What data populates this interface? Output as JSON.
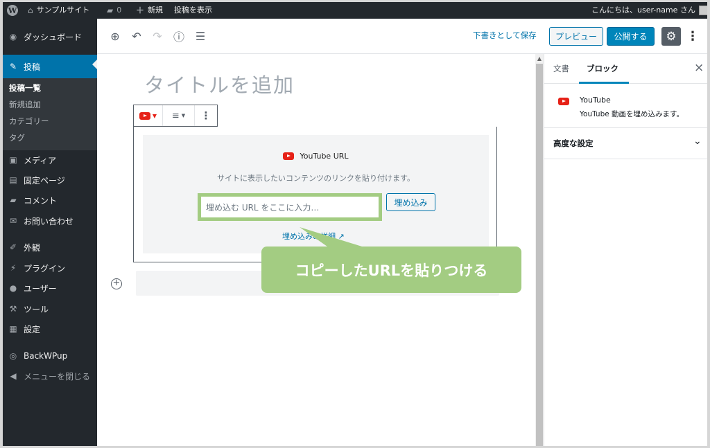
{
  "adminbar": {
    "site_name": "サンプルサイト",
    "comments_count": "0",
    "new_label": "新規",
    "view_post_label": "投稿を表示",
    "greeting": "こんにちは、user-name さん"
  },
  "sidebar": {
    "dashboard": "ダッシュボード",
    "posts": "投稿",
    "submenu": [
      "投稿一覧",
      "新規追加",
      "カテゴリー",
      "タグ"
    ],
    "media": "メディア",
    "pages": "固定ページ",
    "comments": "コメント",
    "contact": "お問い合わせ",
    "appearance": "外観",
    "plugins": "プラグイン",
    "users": "ユーザー",
    "tools": "ツール",
    "settings": "設定",
    "backwpup": "BackWPup",
    "collapse": "メニューを閉じる"
  },
  "toolbar": {
    "save_draft": "下書きとして保存",
    "preview": "プレビュー",
    "publish": "公開する"
  },
  "editor": {
    "title_placeholder": "タイトルを追加",
    "embed_label": "YouTube URL",
    "embed_instructions": "サイトに表示したいコンテンツのリンクを貼り付けます。",
    "url_placeholder": "埋め込む URL をここに入力…",
    "embed_button": "埋め込み",
    "learn_more": "埋め込みの詳細"
  },
  "callout": "コピーしたURLを貼りつける",
  "panel": {
    "tab_document": "文書",
    "tab_block": "ブロック",
    "block_name": "YouTube",
    "block_description": "YouTube 動画を埋め込みます。",
    "advanced": "高度な設定"
  },
  "colors": {
    "accent": "#0073aa",
    "callout": "#a3cc82",
    "youtube": "#e62117"
  }
}
